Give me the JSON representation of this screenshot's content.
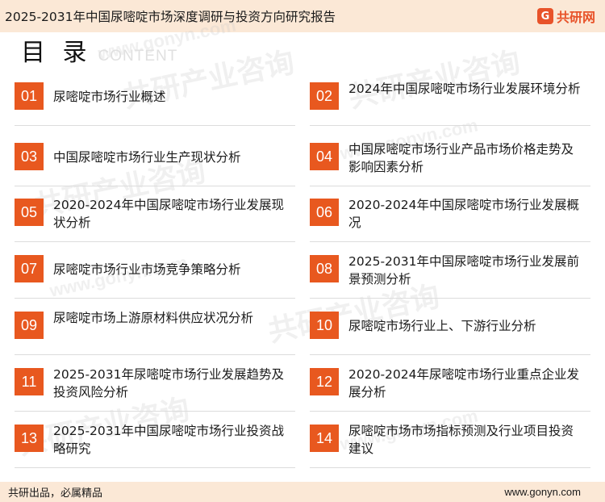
{
  "header": {
    "title": "2025-2031年中国尿嘧啶市场深度调研与投资方向研究报告",
    "brand_mark": "G",
    "brand_name": "共研网"
  },
  "heading": {
    "main": "目 录",
    "sub": "CONTENT"
  },
  "watermark": {
    "brand": "共研产业咨询",
    "url": "www.gonyn.com"
  },
  "toc": [
    {
      "num": "01",
      "label": "尿嘧啶市场行业概述"
    },
    {
      "num": "02",
      "label": "2024年中国尿嘧啶市场行业发展环境分析"
    },
    {
      "num": "03",
      "label": "中国尿嘧啶市场行业生产现状分析"
    },
    {
      "num": "04",
      "label": "中国尿嘧啶市场行业产品市场价格走势及影响因素分析"
    },
    {
      "num": "05",
      "label": "2020-2024年中国尿嘧啶市场行业发展现状分析"
    },
    {
      "num": "06",
      "label": "2020-2024年中国尿嘧啶市场行业发展概况"
    },
    {
      "num": "07",
      "label": "尿嘧啶市场行业市场竞争策略分析"
    },
    {
      "num": "08",
      "label": "2025-2031年中国尿嘧啶市场行业发展前景预测分析"
    },
    {
      "num": "09",
      "label": "尿嘧啶市场上游原材料供应状况分析"
    },
    {
      "num": "10",
      "label": "尿嘧啶市场行业上、下游行业分析"
    },
    {
      "num": "11",
      "label": "2025-2031年尿嘧啶市场行业发展趋势及投资风险分析"
    },
    {
      "num": "12",
      "label": "2020-2024年尿嘧啶市场行业重点企业发展分析"
    },
    {
      "num": "13",
      "label": "2025-2031年中国尿嘧啶市场行业投资战略研究"
    },
    {
      "num": "14",
      "label": "尿嘧啶市场市场指标预测及行业项目投资建议"
    }
  ],
  "footer": {
    "slogan": "共研出品，必属精品",
    "site": "www.gonyn.com"
  }
}
